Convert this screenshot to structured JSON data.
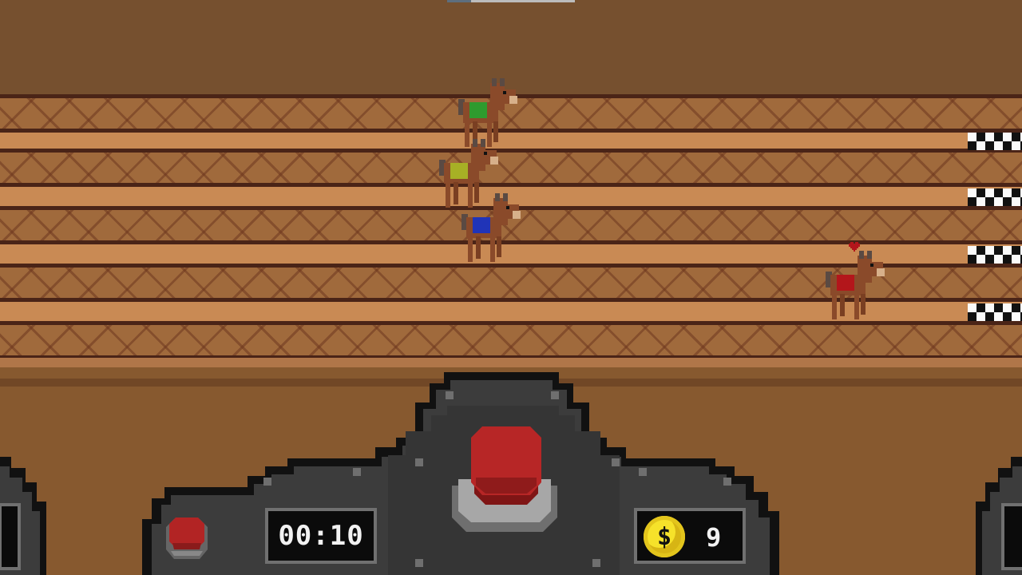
{
  "hud": {
    "timer": "00:10",
    "coin_symbol": "$",
    "coin_count": "9"
  },
  "colors": {
    "horse_green": "#2e9b2e",
    "horse_yellow": "#a7b025",
    "horse_blue": "#2034b8",
    "horse_red": "#b3161b",
    "big_button": "#b72626",
    "small_button": "#b22424",
    "coin": "#f6e22a"
  },
  "lanes": [
    {
      "saddle_color": "green"
    },
    {
      "saddle_color": "yellow"
    },
    {
      "saddle_color": "blue"
    },
    {
      "saddle_color": "red"
    }
  ],
  "icons": {
    "heart": "heart-icon",
    "coin": "coin-icon",
    "finish": "checkered-flag-icon"
  }
}
